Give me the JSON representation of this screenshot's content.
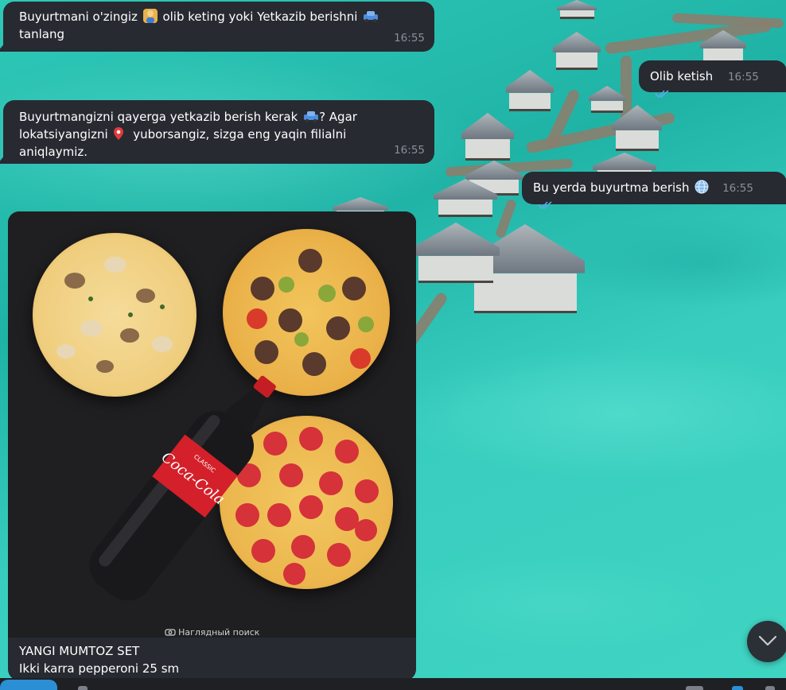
{
  "messages": [
    {
      "id": "msg1",
      "direction": "incoming",
      "lines": [
        "Buyurtmani o'zingiz",
        "olib keting yoki Yetkazib berishni",
        "tanlang"
      ],
      "emojis": [
        "person-icon",
        "car-icon"
      ],
      "time": "16:55"
    },
    {
      "id": "msg2",
      "direction": "outgoing",
      "text": "Olib ketish",
      "time": "16:55",
      "status": "read"
    },
    {
      "id": "msg3",
      "direction": "incoming",
      "lines": [
        "Buyurtmangizni qayerga yetkazib berish kerak",
        "? Agar",
        "lokatsiyangizni",
        "yuborsangiz, sizga eng yaqin filialni aniqlaymiz."
      ],
      "emojis": [
        "car-icon",
        "pin-icon"
      ],
      "time": "16:55"
    },
    {
      "id": "msg4",
      "direction": "outgoing",
      "text": "Bu yerda buyurtma berish",
      "emoji": "globe-icon",
      "time": "16:55",
      "status": "read"
    }
  ],
  "media_card": {
    "watermark": "Наглядный поиск",
    "caption_lines": [
      "YANGI MUMTOZ SET",
      "Ikki karra pepperoni 25 sm"
    ],
    "bottle_label": "Coca-Cola",
    "bottle_sub": "CLASSIC"
  },
  "colors": {
    "bubble": "#272a31",
    "time": "#8b8f97",
    "read_check": "#5ea9ea",
    "accent": "#2b8fd6"
  },
  "icons": {
    "scroll_down": "chevron-down-icon",
    "read_status": "double-check-icon"
  }
}
